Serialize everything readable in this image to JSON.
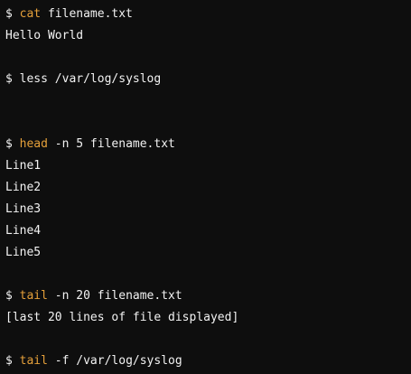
{
  "terminal": {
    "blocks": [
      {
        "prompt": "$",
        "command": "cat",
        "args": "filename.txt",
        "output": [
          "Hello World"
        ]
      },
      {
        "prompt": "$",
        "command": "less",
        "args": "/var/log/syslog",
        "output": []
      },
      {
        "prompt": "$",
        "command": "head",
        "args": "-n 5 filename.txt",
        "output": [
          "Line1",
          "Line2",
          "Line3",
          "Line4",
          "Line5"
        ]
      },
      {
        "prompt": "$",
        "command": "tail",
        "args": "-n 20 filename.txt",
        "output": [
          "[last 20 lines of file displayed]"
        ]
      },
      {
        "prompt": "$",
        "command": "tail",
        "args": "-f /var/log/syslog",
        "output": []
      }
    ],
    "colors": {
      "background": "#0e0e0e",
      "text": "#f2f2f2",
      "command_highlight": "#e5a03a"
    }
  }
}
